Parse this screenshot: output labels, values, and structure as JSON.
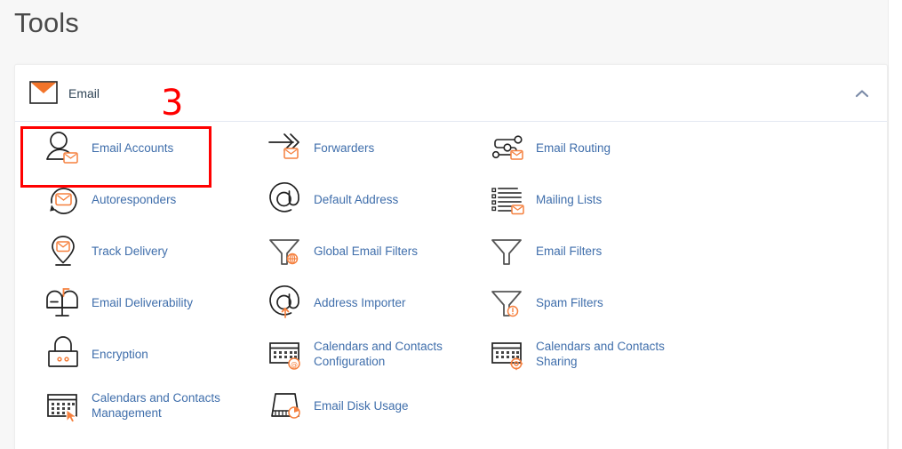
{
  "page": {
    "title": "Tools"
  },
  "colors": {
    "link": "#3f6eab",
    "heading": "#4a4a4a",
    "section_title": "#2e4355",
    "icon_gray": "#4a4a4a",
    "icon_orange": "#f5803e",
    "annotation_red": "#ff0000",
    "panel_bg": "#ffffff",
    "page_bg": "#f7f7f7"
  },
  "section": {
    "title": "Email",
    "icon": "envelope-icon",
    "collapse_icon": "chevron-up-icon",
    "expanded": true
  },
  "annotations": {
    "step_number": "3",
    "highlight_target": "Email Accounts"
  },
  "tools": {
    "columns": [
      {
        "items": [
          {
            "label": "Email Accounts",
            "icon": "user-envelope-icon",
            "highlighted": true
          },
          {
            "label": "Autoresponders",
            "icon": "circular-arrow-envelope-icon",
            "highlighted": false
          },
          {
            "label": "Track Delivery",
            "icon": "map-pin-envelope-icon",
            "highlighted": false
          },
          {
            "label": "Email Deliverability",
            "icon": "mailbox-icon",
            "highlighted": false
          },
          {
            "label": "Encryption",
            "icon": "padlock-icon",
            "highlighted": false
          },
          {
            "label": "Calendars and Contacts Management",
            "icon": "calendar-cursor-icon",
            "highlighted": false
          }
        ]
      },
      {
        "items": [
          {
            "label": "Forwarders",
            "icon": "arrows-envelope-icon",
            "highlighted": false
          },
          {
            "label": "Default Address",
            "icon": "at-sign-icon",
            "highlighted": false
          },
          {
            "label": "Global Email Filters",
            "icon": "funnel-globe-icon",
            "highlighted": false
          },
          {
            "label": "Address Importer",
            "icon": "at-sign-upload-icon",
            "highlighted": false
          },
          {
            "label": "Calendars and Contacts Configuration",
            "icon": "calendar-at-icon",
            "highlighted": false
          },
          {
            "label": "Email Disk Usage",
            "icon": "disk-pie-icon",
            "highlighted": false
          }
        ]
      },
      {
        "items": [
          {
            "label": "Email Routing",
            "icon": "routing-envelope-icon",
            "highlighted": false
          },
          {
            "label": "Mailing Lists",
            "icon": "list-envelope-icon",
            "highlighted": false
          },
          {
            "label": "Email Filters",
            "icon": "funnel-icon",
            "highlighted": false
          },
          {
            "label": "Spam Filters",
            "icon": "funnel-alert-icon",
            "highlighted": false
          },
          {
            "label": "Calendars and Contacts Sharing",
            "icon": "calendar-gear-icon",
            "highlighted": false
          }
        ]
      }
    ]
  }
}
